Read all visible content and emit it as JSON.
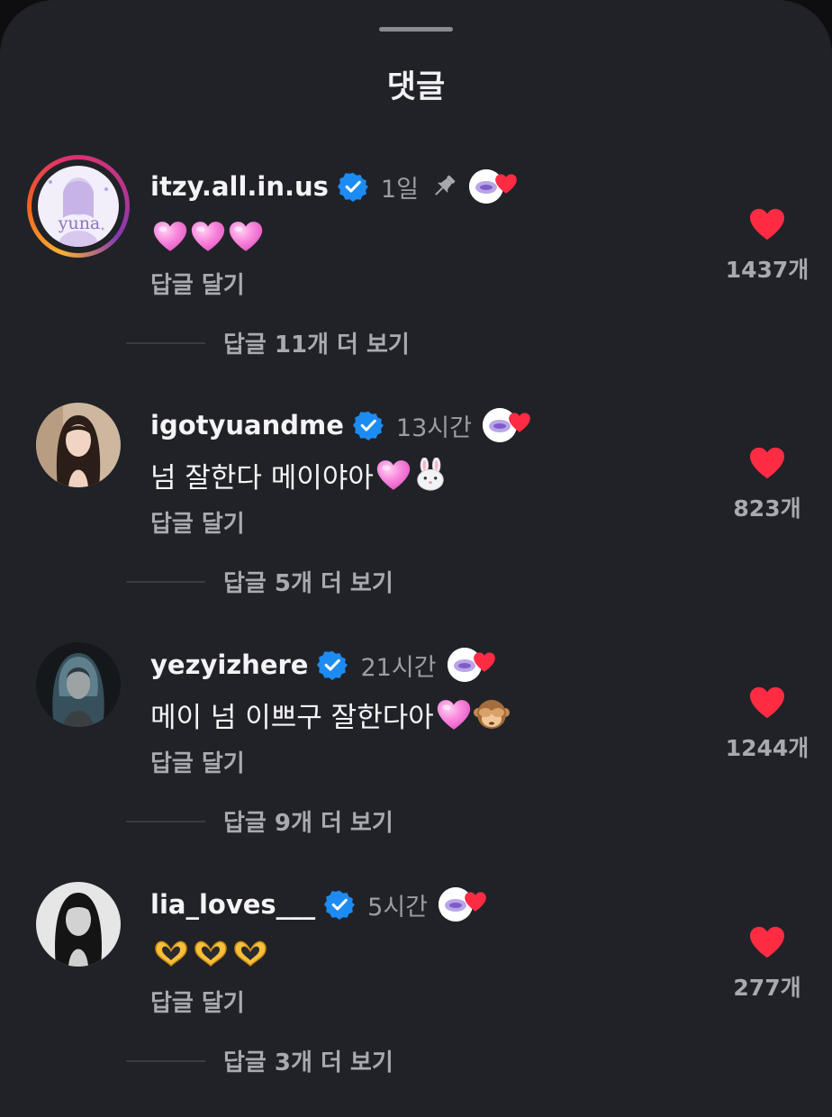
{
  "header": {
    "title": "댓글"
  },
  "comments": [
    {
      "username": "itzy.all.in.us",
      "time": "1일",
      "pinned": true,
      "text": "",
      "emoji": [
        "pink-heart",
        "pink-heart",
        "pink-heart"
      ],
      "reply_label": "답글 달기",
      "like_count": "1437개",
      "more_replies": "답글 11개 더 보기",
      "avatar_text": "yuna"
    },
    {
      "username": "igotyuandme",
      "time": "13시간",
      "pinned": false,
      "text": "넘 잘한다 메이야아",
      "emoji": [
        "pink-heart",
        "rabbit-face"
      ],
      "reply_label": "답글 달기",
      "like_count": "823개",
      "more_replies": "답글 5개 더 보기"
    },
    {
      "username": "yezyizhere",
      "time": "21시간",
      "pinned": false,
      "text": "메이 넘 이쁘구 잘한다아",
      "emoji": [
        "pink-heart",
        "see-no-evil-monkey"
      ],
      "reply_label": "답글 달기",
      "like_count": "1244개",
      "more_replies": "답글 9개 더 보기"
    },
    {
      "username": "lia_loves___",
      "time": "5시간",
      "pinned": false,
      "text": "",
      "emoji": [
        "heart-hands",
        "heart-hands",
        "heart-hands"
      ],
      "reply_label": "답글 달기",
      "like_count": "277개",
      "more_replies": "답글 3개 더 보기"
    }
  ],
  "colors": {
    "background": "#212227",
    "like_red": "#fe2c43",
    "verified_blue": "#1d8cf2",
    "pink_heart": "#f77ad7",
    "muted_text": "#a9aab0"
  }
}
